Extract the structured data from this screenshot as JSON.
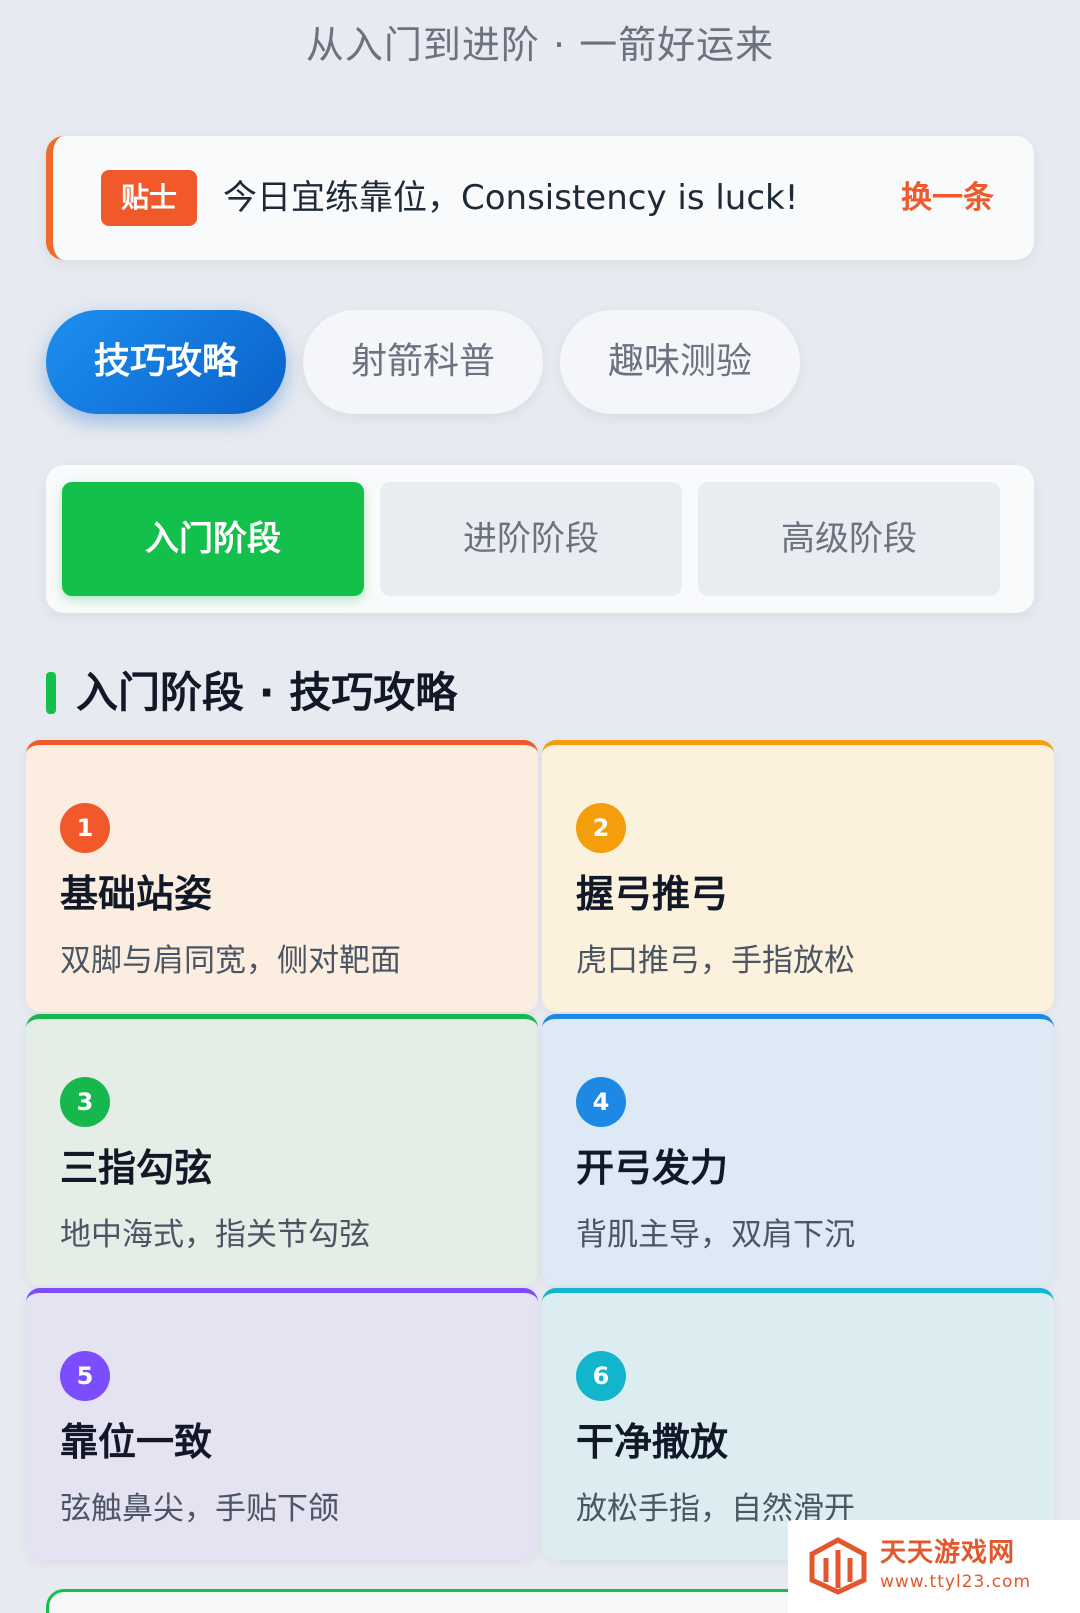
{
  "header": {
    "subtitle": "从入门到进阶 · 一箭好运来"
  },
  "tip": {
    "badge": "贴士",
    "text": "今日宜练靠位，Consistency is luck!",
    "refresh_label": "换一条",
    "accent_color": "#f2592a"
  },
  "category_tabs": [
    {
      "label": "技巧攻略",
      "active": true
    },
    {
      "label": "射箭科普",
      "active": false
    },
    {
      "label": "趣味测验",
      "active": false
    }
  ],
  "stage_tabs": [
    {
      "label": "入门阶段",
      "active": true
    },
    {
      "label": "进阶阶段",
      "active": false
    },
    {
      "label": "高级阶段",
      "active": false
    }
  ],
  "section": {
    "title": "入门阶段 · 技巧攻略",
    "accent_color": "#12c04b"
  },
  "cards": [
    {
      "num": "1",
      "title": "基础站姿",
      "desc": "双脚与肩同宽，侧对靶面",
      "color": "#f2592a",
      "bg": "#fbeee0"
    },
    {
      "num": "2",
      "title": "握弓推弓",
      "desc": "虎口推弓，手指放松",
      "color": "#f59e0b",
      "bg": "#fbf1dc"
    },
    {
      "num": "3",
      "title": "三指勾弦",
      "desc": "地中海式，指关节勾弦",
      "color": "#16b84e",
      "bg": "#e4ede6"
    },
    {
      "num": "4",
      "title": "开弓发力",
      "desc": "背肌主导，双肩下沉",
      "color": "#1e88e5",
      "bg": "#dde9f5"
    },
    {
      "num": "5",
      "title": "靠位一致",
      "desc": "弦触鼻尖，手贴下颌",
      "color": "#7c4dff",
      "bg": "#e5e3f1"
    },
    {
      "num": "6",
      "title": "干净撒放",
      "desc": "放松手指，自然滑开",
      "color": "#12b5cb",
      "bg": "#dcedf1"
    }
  ],
  "watermark": {
    "name": "天天游戏网",
    "url": "www.ttyl23.com"
  }
}
